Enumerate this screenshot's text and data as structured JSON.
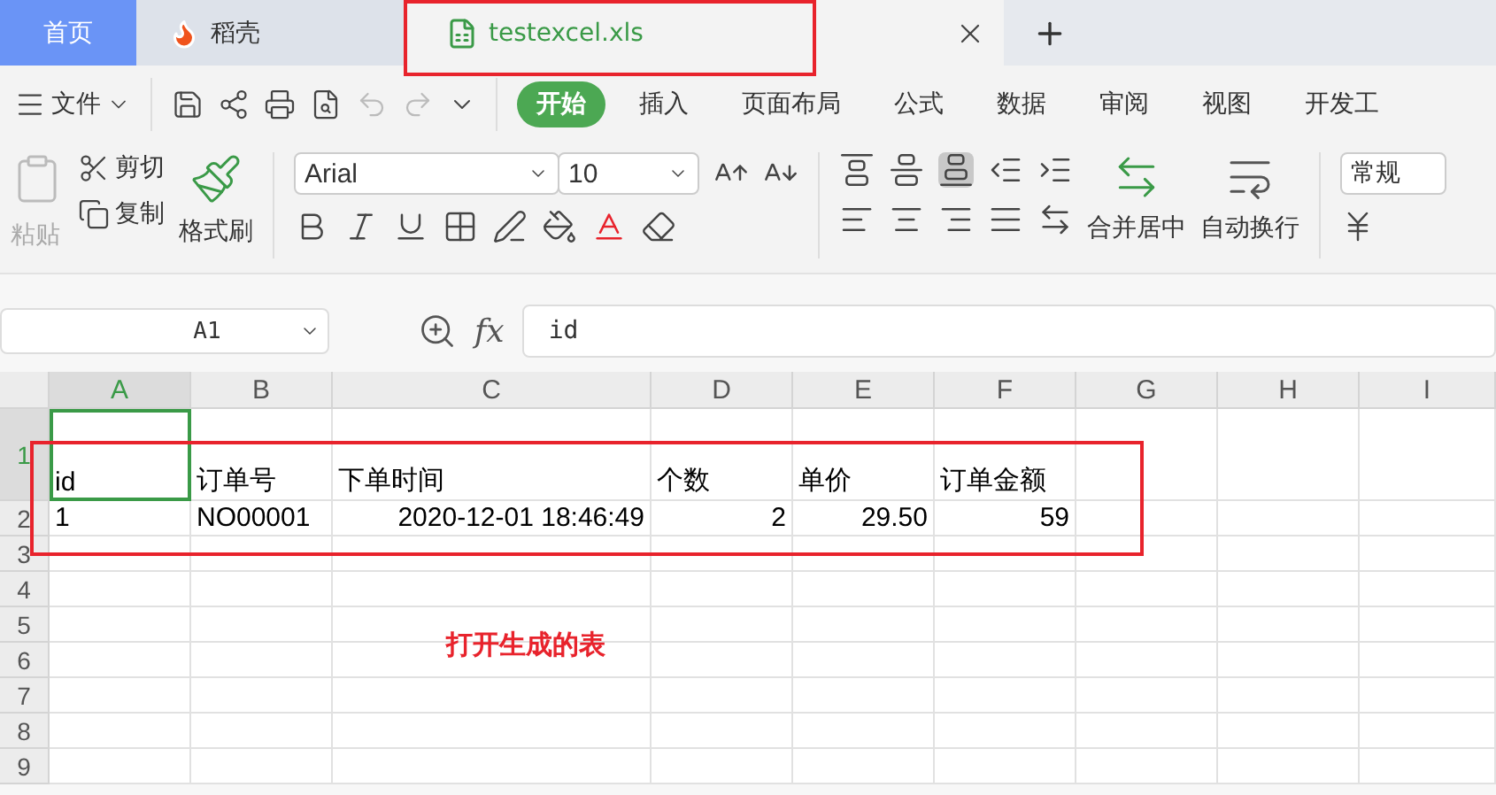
{
  "tabs": [
    {
      "label": "首页",
      "kind": "home",
      "selected": false
    },
    {
      "label": "稻壳",
      "kind": "store",
      "selected": false
    },
    {
      "label": "testexcel.xls",
      "kind": "sheet",
      "selected": true
    }
  ],
  "menu": {
    "file": "文件",
    "tabs": [
      {
        "label": "开始",
        "selected": true
      },
      {
        "label": "插入",
        "selected": false
      },
      {
        "label": "页面布局",
        "selected": false
      },
      {
        "label": "公式",
        "selected": false
      },
      {
        "label": "数据",
        "selected": false
      },
      {
        "label": "审阅",
        "selected": false
      },
      {
        "label": "视图",
        "selected": false
      },
      {
        "label": "开发工",
        "selected": false
      }
    ]
  },
  "ribbon": {
    "paste": {
      "label": "粘贴",
      "disabled": true
    },
    "cut": "剪切",
    "copy": "复制",
    "format_painter": "格式刷",
    "font": "Arial",
    "font_size": "10",
    "merge": "合并居中",
    "wrap": "自动换行",
    "number_format": "常规"
  },
  "formula_bar": {
    "name_box": "A1",
    "fx_label": "fx",
    "formula": "id"
  },
  "sheet": {
    "columns": [
      {
        "label": "A",
        "selected": true
      },
      {
        "label": "B",
        "selected": false
      },
      {
        "label": "C",
        "selected": false
      },
      {
        "label": "D",
        "selected": false
      },
      {
        "label": "E",
        "selected": false
      },
      {
        "label": "F",
        "selected": false
      },
      {
        "label": "G",
        "selected": false
      },
      {
        "label": "H",
        "selected": false
      },
      {
        "label": "I",
        "selected": false
      }
    ],
    "rows": [
      {
        "number": "1",
        "selected": true,
        "cells": [
          {
            "text": "id",
            "numeric": false
          },
          {
            "text": "订单号",
            "numeric": false
          },
          {
            "text": "下单时间",
            "numeric": false
          },
          {
            "text": "个数",
            "numeric": false
          },
          {
            "text": "单价",
            "numeric": false
          },
          {
            "text": "订单金额",
            "numeric": false
          }
        ]
      },
      {
        "number": "2",
        "selected": false,
        "cells": [
          {
            "text": "1",
            "numeric": false
          },
          {
            "text": "NO00001",
            "numeric": false
          },
          {
            "text": "2020-12-01 18:46:49",
            "numeric": true
          },
          {
            "text": "2",
            "numeric": true
          },
          {
            "text": "29.50",
            "numeric": true
          },
          {
            "text": "59",
            "numeric": true
          }
        ]
      },
      {
        "number": "3",
        "selected": false,
        "cells": []
      },
      {
        "number": "4",
        "selected": false,
        "cells": []
      },
      {
        "number": "5",
        "selected": false,
        "cells": []
      },
      {
        "number": "6",
        "selected": false,
        "cells": []
      },
      {
        "number": "7",
        "selected": false,
        "cells": []
      },
      {
        "number": "8",
        "selected": false,
        "cells": []
      },
      {
        "number": "9",
        "selected": false,
        "cells": []
      }
    ]
  },
  "annotation": {
    "note": "打开生成的表"
  }
}
